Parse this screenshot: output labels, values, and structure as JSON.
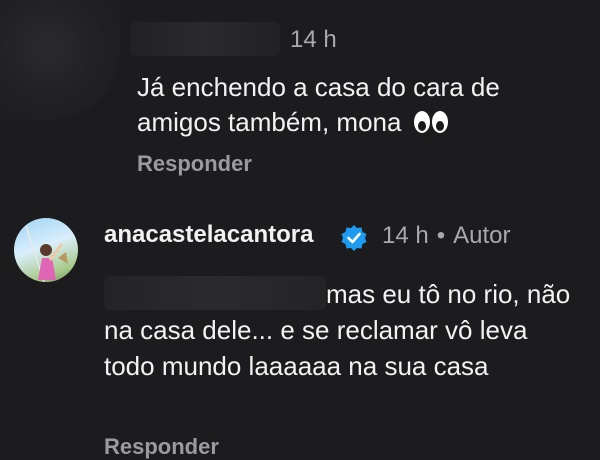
{
  "comment1": {
    "timestamp": "14 h",
    "text": "Já enchendo a casa do cara de amigos também, mona",
    "emoji": "eyes",
    "reply_label": "Responder"
  },
  "comment2": {
    "username": "anacastelacantora",
    "verified_icon": "verified-badge-icon",
    "timestamp": "14 h",
    "separator": "•",
    "author_label": "Autor",
    "text": "mas eu tô no rio, não na casa dele... e se reclamar vô leva todo mundo laaaaaa na sua casa",
    "reply_label": "Responder"
  },
  "colors": {
    "background": "#1c1c1e",
    "text": "#f2f2f2",
    "muted": "#a8a8ad",
    "verified": "#1d9bf0"
  }
}
